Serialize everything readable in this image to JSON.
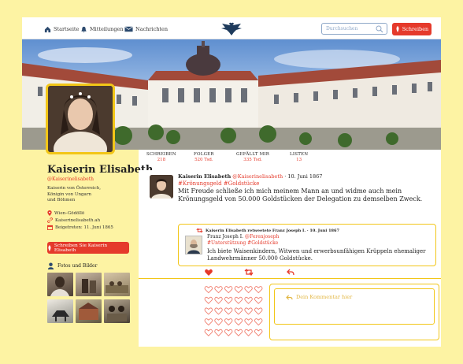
{
  "nav": {
    "home": "Startseite",
    "notifications": "Mitteilungen",
    "messages": "Nachrichten",
    "search_placeholder": "Durchsuchen",
    "write": "Schreiben"
  },
  "profile": {
    "name": "Kaiserin Elisabeth",
    "handle": "@Kaiserinelisabeth",
    "bio": "Kaiserin von Österreich,\nKönigin von Ungarn\nund Böhmen",
    "location": "Wien–Gödöllö",
    "website": "Kaiserinelisabeth.ah",
    "joined": "Beigetreten: 11. Juni 1865",
    "write_button": "Schreiben Sie Kaiserin Elisabeth",
    "photos_title": "Fotos und Bilder"
  },
  "stats": [
    {
      "label": "SCHREIBEN",
      "value": "218"
    },
    {
      "label": "FOLGER",
      "value": "520 Tsd."
    },
    {
      "label": "GEFÄLLT MIR",
      "value": "335 Tsd."
    },
    {
      "label": "LISTEN",
      "value": "13"
    }
  ],
  "post": {
    "author": "Kaiserin Elisabeth",
    "handle": "@Kaiserinelisabeth",
    "date": "· 10. Juni 1867",
    "tags": "#Krönungsgeld #Goldstücke",
    "text": "Mit Freude schließe ich mich meinem Mann an und widme auch mein Krönungsgeld von 50.000 Goldstücken der Delegation zu demselben Zweck.",
    "quote": {
      "retweet_line": "Kaiserin Elisabeth retweetete Franz Joseph I. · 10. Juni 1867",
      "author": "Franz Joseph I.",
      "handle": "@Ferenjoseph",
      "tags": "#Unterstützung #Goldstücke",
      "text": "Ich biete Waisenkindern, Witwen und erwerbsunfähigen Krüppeln ehemaliger Landwehrmänner 50.000 Goldstücke."
    }
  },
  "comment": {
    "label": "Dein Kommentar hier"
  },
  "colors": {
    "accent_red": "#e53a2b",
    "accent_yellow": "#f2c618",
    "page_bg": "#fdf3a3"
  },
  "icons": [
    "home-icon",
    "bell-icon",
    "mail-icon",
    "eagle-logo-icon",
    "search-icon",
    "quill-icon",
    "location-pin-icon",
    "link-icon",
    "calendar-icon",
    "photos-icon",
    "heart-icon",
    "retweet-icon",
    "reply-icon"
  ]
}
